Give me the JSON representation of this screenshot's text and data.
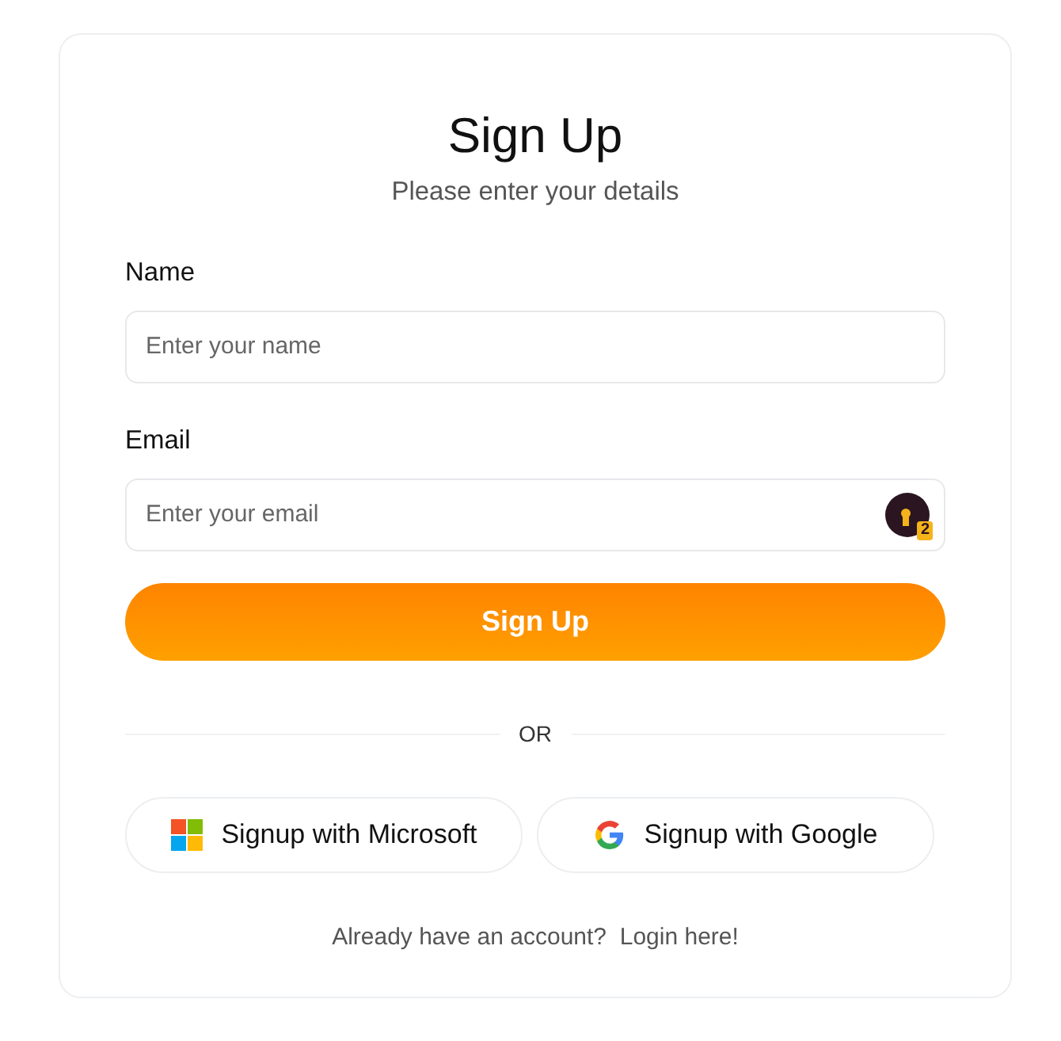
{
  "title": "Sign Up",
  "subtitle": "Please enter your details",
  "fields": [
    {
      "label": "Name",
      "placeholder": "Enter your name"
    },
    {
      "label": "Email",
      "placeholder": "Enter your email",
      "badge": "2"
    }
  ],
  "submit": "Sign Up",
  "divider": "OR",
  "social": [
    {
      "kind": "microsoft",
      "label": "Signup with Microsoft"
    },
    {
      "kind": "google",
      "label": "Signup with Google"
    }
  ],
  "footer": {
    "text": "Already have an account?",
    "link": "Login here!"
  }
}
